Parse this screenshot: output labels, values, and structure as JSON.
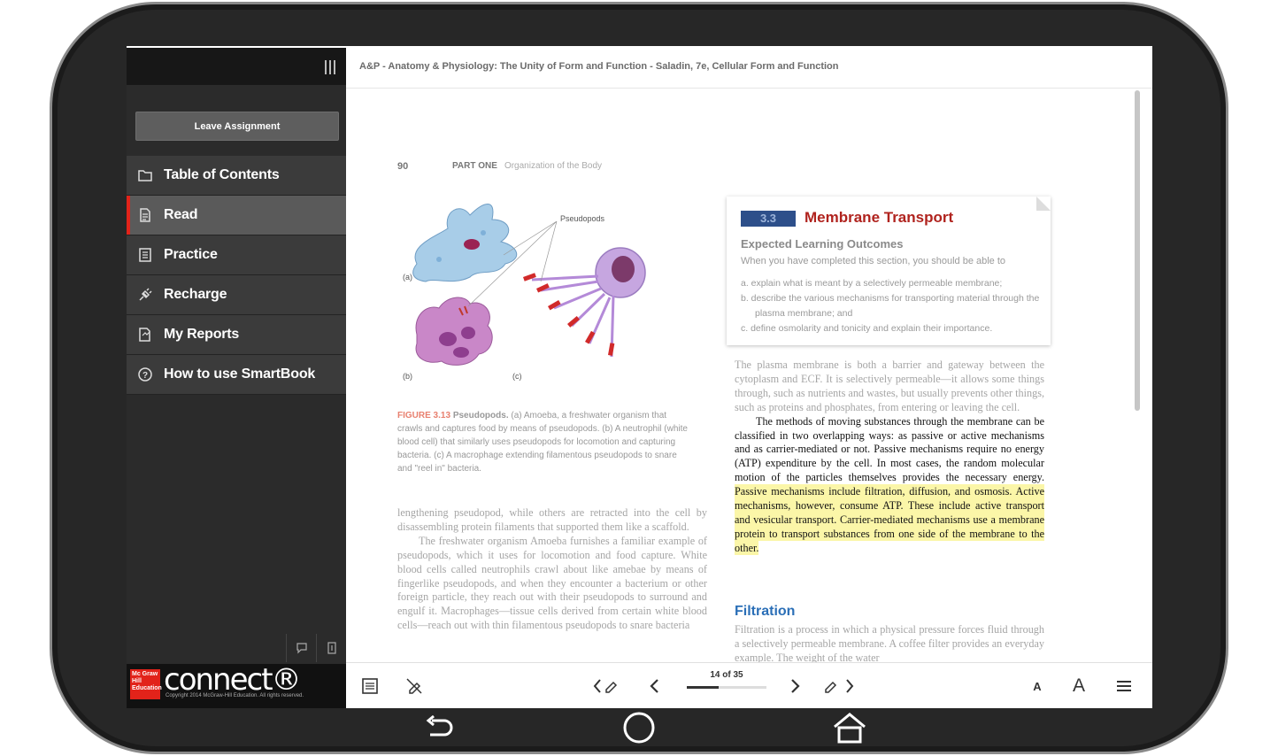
{
  "header": {
    "title": "A&P - Anatomy & Physiology: The Unity of Form and Function - Saladin, 7e, Cellular Form and Function"
  },
  "sidebar": {
    "leave_label": "Leave Assignment",
    "items": [
      {
        "label": "Table of Contents",
        "icon": "folder-icon"
      },
      {
        "label": "Read",
        "icon": "document-icon",
        "active": true
      },
      {
        "label": "Practice",
        "icon": "list-icon"
      },
      {
        "label": "Recharge",
        "icon": "plug-icon"
      },
      {
        "label": "My Reports",
        "icon": "report-icon"
      },
      {
        "label": "How to use SmartBook",
        "icon": "help-icon"
      }
    ],
    "brand_logo": "Mc Graw Hill Education",
    "brand_name": "connect®",
    "copyright": "Copyright 2014 McGraw-Hill Education. All rights reserved."
  },
  "page": {
    "number": "90",
    "part": "PART ONE",
    "part_title": "Organization of the Body",
    "figure": {
      "label_pseudopods": "Pseudopods",
      "label_a": "(a)",
      "label_b": "(b)",
      "label_c": "(c)",
      "caption_num": "FIGURE 3.13",
      "caption_title": "Pseudopods.",
      "caption_text": " (a) Amoeba, a freshwater organism that crawls and captures food by means of pseudopods. (b) A neutrophil (white blood cell) that similarly uses pseudopods for locomotion and capturing bacteria. (c) A macrophage extending filamentous pseudopods to snare and \"reel in\" bacteria."
    },
    "left_p1": "lengthening pseudopod, while others are retracted into the cell by disassembling protein filaments that supported them like a scaffold.",
    "left_p2": "The freshwater organism Amoeba furnishes a familiar example of pseudopods, which it uses for locomotion and food capture. White blood cells called neutrophils crawl about like amebae by means of fingerlike pseudopods, and when they encounter a bacterium or other foreign particle, they reach out with their pseudopods to surround and engulf it. Macrophages—tissue cells derived from certain white blood cells—reach out with thin filamentous pseudopods to snare bacteria",
    "section": {
      "num": "3.3",
      "title": "Membrane Transport",
      "outcomes_heading": "Expected Learning Outcomes",
      "intro": "When you have completed this section, you should be able to",
      "outcomes": [
        "a.  explain what is meant by a selectively permeable membrane;",
        "b.  describe the various mechanisms for transporting material through the plasma membrane; and",
        "c.  define osmolarity and tonicity and explain their importance."
      ]
    },
    "right_p1": "The plasma membrane is both a barrier and gateway between the cytoplasm and ECF. It is selectively permeable—it allows some things through, such as nutrients and wastes, but usually prevents other things, such as proteins and phosphates, from entering or leaving the cell.",
    "right_p2_plain": "The methods of moving substances through the membrane can be classified in two overlapping ways: as passive or active mechanisms and as carrier-mediated or not. Passive mechanisms require no energy (ATP) expenditure by the cell. In most cases, the random molecular motion of the particles themselves provides the necessary energy. ",
    "right_p2_highlight": "Passive mechanisms include filtration, diffusion, and osmosis. Active mechanisms, however, consume ATP. These include active transport and vesicular transport. Carrier-mediated mechanisms use a membrane protein to transport substances from one side of the membrane to the other.",
    "filtration_heading": "Filtration",
    "filtration_text": "Filtration is a process in which a physical pressure forces fluid through a selectively permeable membrane. A coffee filter provides an everyday example. The weight of the water"
  },
  "toolbar": {
    "pager_text": "14 of 35",
    "progress": 0.4,
    "font_small": "A",
    "font_large": "A"
  },
  "colors": {
    "accent_red": "#e2231a",
    "section_blue": "#2d4f8a",
    "highlight": "#fbf6a8",
    "heading_blue": "#2b6fb7"
  }
}
